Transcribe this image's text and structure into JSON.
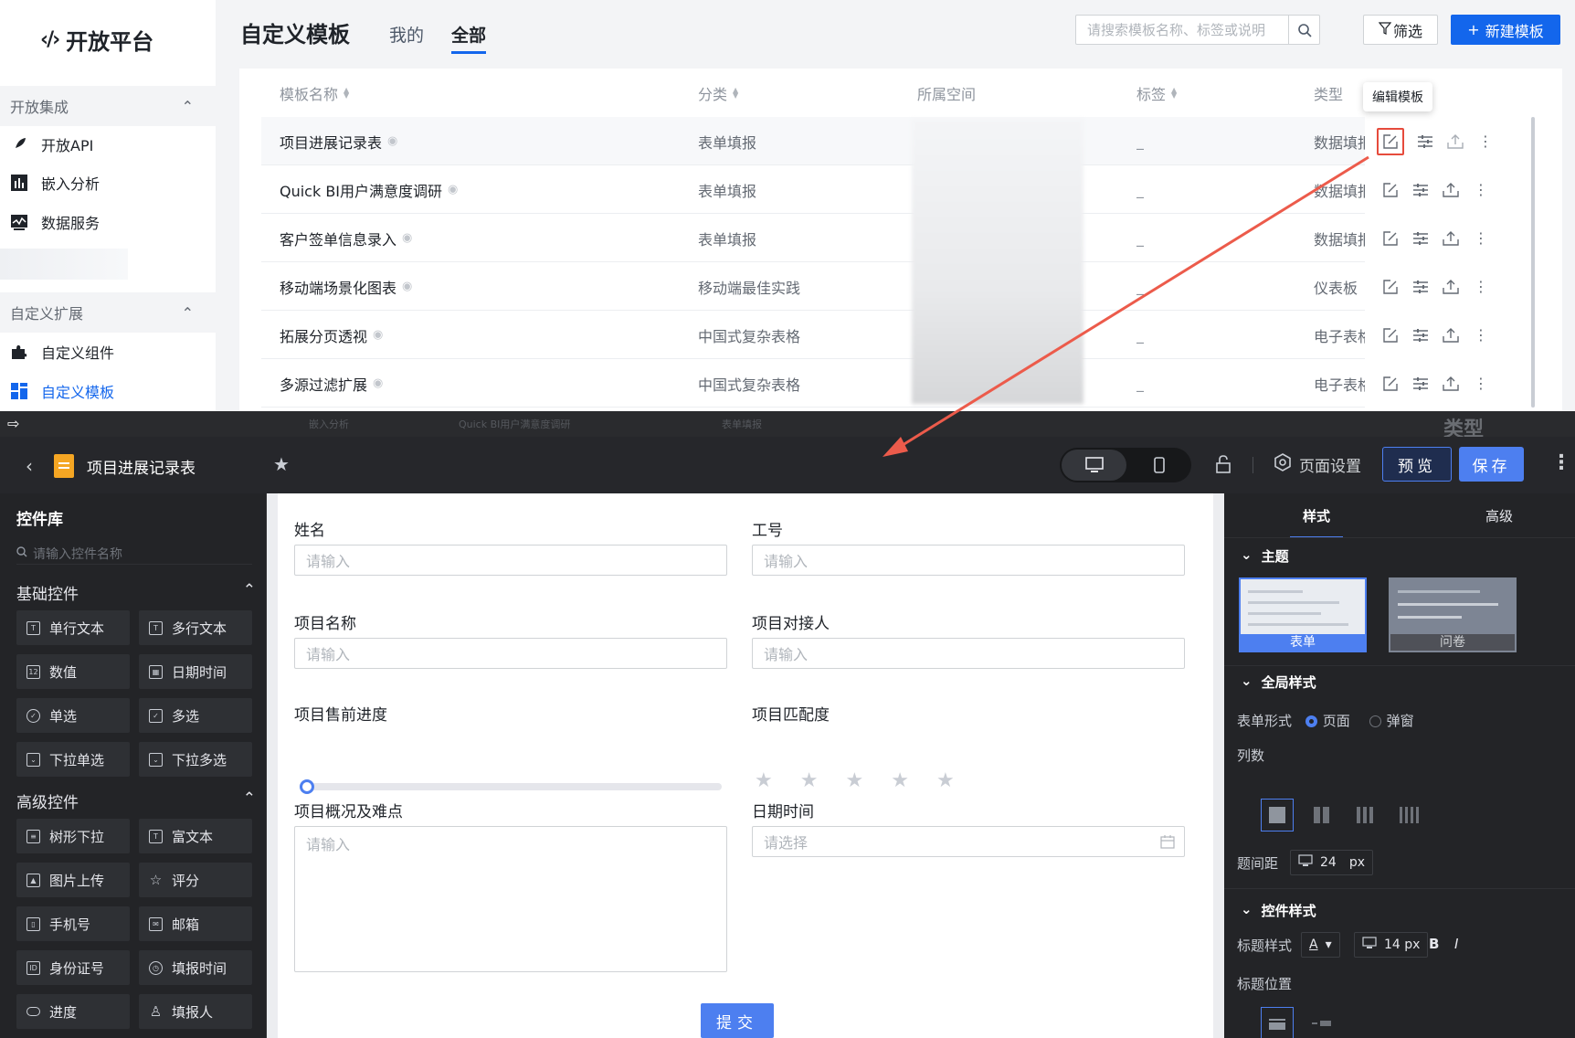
{
  "portal": {
    "logo": "开放平台",
    "sections": [
      {
        "title": "开放集成",
        "items": [
          "开放API",
          "嵌入分析",
          "数据服务"
        ]
      },
      {
        "title": "自定义扩展",
        "items": [
          "自定义组件",
          "自定义模板"
        ]
      }
    ],
    "active_item": "自定义模板",
    "page_title": "自定义模板",
    "tabs": [
      "我的",
      "全部"
    ],
    "active_tab": "全部",
    "search_placeholder": "请搜索模板名称、标签或说明",
    "filter_label": "筛选",
    "new_label": "新建模板",
    "columns": [
      "模板名称",
      "分类",
      "所属空间",
      "标签",
      "类型"
    ],
    "rows": [
      {
        "name": "项目进展记录表",
        "category": "表单填报",
        "tag": "_",
        "type": "数据填报"
      },
      {
        "name": "Quick BI用户满意度调研",
        "category": "表单填报",
        "tag": "_",
        "type": "数据填报"
      },
      {
        "name": "客户签单信息录入",
        "category": "表单填报",
        "tag": "_",
        "type": "数据填报"
      },
      {
        "name": "移动端场景化图表",
        "category": "移动端最佳实践",
        "tag": "_",
        "type": "仪表板"
      },
      {
        "name": "拓展分页透视",
        "category": "中国式复杂表格",
        "tag": "_",
        "type": "电子表格"
      },
      {
        "name": "多源过滤扩展",
        "category": "中国式复杂表格",
        "tag": "_",
        "type": "电子表格"
      }
    ],
    "tooltip": "编辑模板",
    "ghost_text": {
      "a": "嵌入分析",
      "b": "Quick BI用户满意度调研",
      "c": "表单填报",
      "big": "类型"
    }
  },
  "editor": {
    "title": "项目进展记录表",
    "page_settings": "页面设置",
    "preview": "预览",
    "save": "保存",
    "library": {
      "title": "控件库",
      "search_placeholder": "请输入控件名称",
      "basic_title": "基础控件",
      "basic": [
        "单行文本",
        "多行文本",
        "数值",
        "日期时间",
        "单选",
        "多选",
        "下拉单选",
        "下拉多选"
      ],
      "advanced_title": "高级控件",
      "advanced": [
        "树形下拉",
        "富文本",
        "图片上传",
        "评分",
        "手机号",
        "邮箱",
        "身份证号",
        "填报时间",
        "进度",
        "填报人"
      ]
    },
    "form": {
      "name_label": "姓名",
      "id_label": "工号",
      "project_label": "项目名称",
      "contact_label": "项目对接人",
      "progress_label": "项目售前进度",
      "match_label": "项目匹配度",
      "overview_label": "项目概况及难点",
      "date_label": "日期时间",
      "input_placeholder": "请输入",
      "date_placeholder": "请选择",
      "submit": "提交",
      "progress_value": 0,
      "rating_value": 0
    },
    "props": {
      "tab_style": "样式",
      "tab_advanced": "高级",
      "theme_title": "主题",
      "theme_form": "表单",
      "theme_survey": "问卷",
      "global_title": "全局样式",
      "form_mode_label": "表单形式",
      "mode_page": "页面",
      "mode_popup": "弹窗",
      "columns_label": "列数",
      "spacing_label": "题间距",
      "spacing_value": "24",
      "spacing_unit": "px",
      "control_title": "控件样式",
      "title_style_label": "标题样式",
      "title_font_size": "14 px",
      "title_pos_label": "标题位置"
    }
  }
}
